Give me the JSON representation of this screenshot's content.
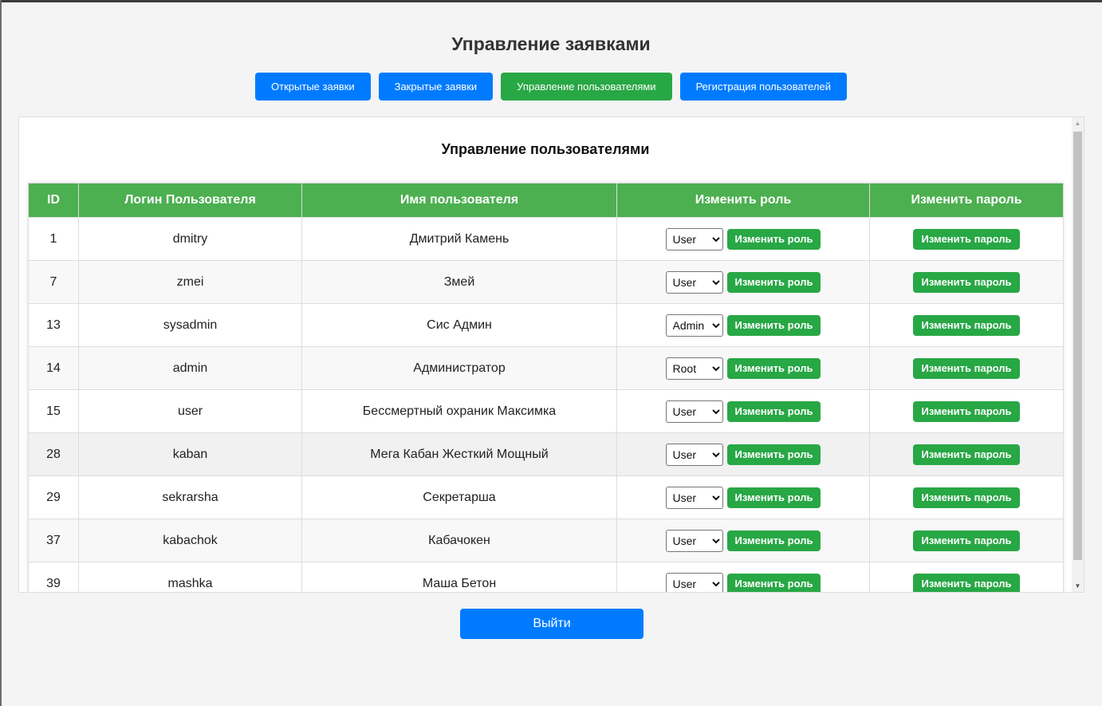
{
  "page": {
    "title": "Управление заявками"
  },
  "nav": {
    "items": [
      {
        "label": "Открытые заявки",
        "active": false
      },
      {
        "label": "Закрытые заявки",
        "active": false
      },
      {
        "label": "Управление пользователями",
        "active": true
      },
      {
        "label": "Регистрация пользователей",
        "active": false
      }
    ]
  },
  "panel": {
    "title": "Управление пользователями"
  },
  "table": {
    "headers": [
      "ID",
      "Логин Пользователя",
      "Имя пользователя",
      "Изменить роль",
      "Изменить пароль"
    ],
    "change_role_label": "Изменить роль",
    "change_password_label": "Изменить пароль",
    "role_options": [
      "User",
      "Admin",
      "Root"
    ],
    "rows": [
      {
        "id": "1",
        "login": "dmitry",
        "name": "Дмитрий Камень",
        "role": "User"
      },
      {
        "id": "7",
        "login": "zmei",
        "name": "Змей",
        "role": "User"
      },
      {
        "id": "13",
        "login": "sysadmin",
        "name": "Сис Админ",
        "role": "Admin"
      },
      {
        "id": "14",
        "login": "admin",
        "name": "Администратор",
        "role": "Root"
      },
      {
        "id": "15",
        "login": "user",
        "name": "Бессмертный охраник Максимка",
        "role": "User"
      },
      {
        "id": "28",
        "login": "kaban",
        "name": "Мега Кабан Жесткий Мощный",
        "role": "User"
      },
      {
        "id": "29",
        "login": "sekrarsha",
        "name": "Секретарша",
        "role": "User"
      },
      {
        "id": "37",
        "login": "kabachok",
        "name": "Кабачокен",
        "role": "User"
      },
      {
        "id": "39",
        "login": "mashka",
        "name": "Маша Бетон",
        "role": "User"
      }
    ]
  },
  "logout": {
    "label": "Выйти"
  },
  "colors": {
    "primary": "#007bff",
    "success": "#28a745",
    "table_header": "#4caf50",
    "background": "#f4f4f4"
  }
}
